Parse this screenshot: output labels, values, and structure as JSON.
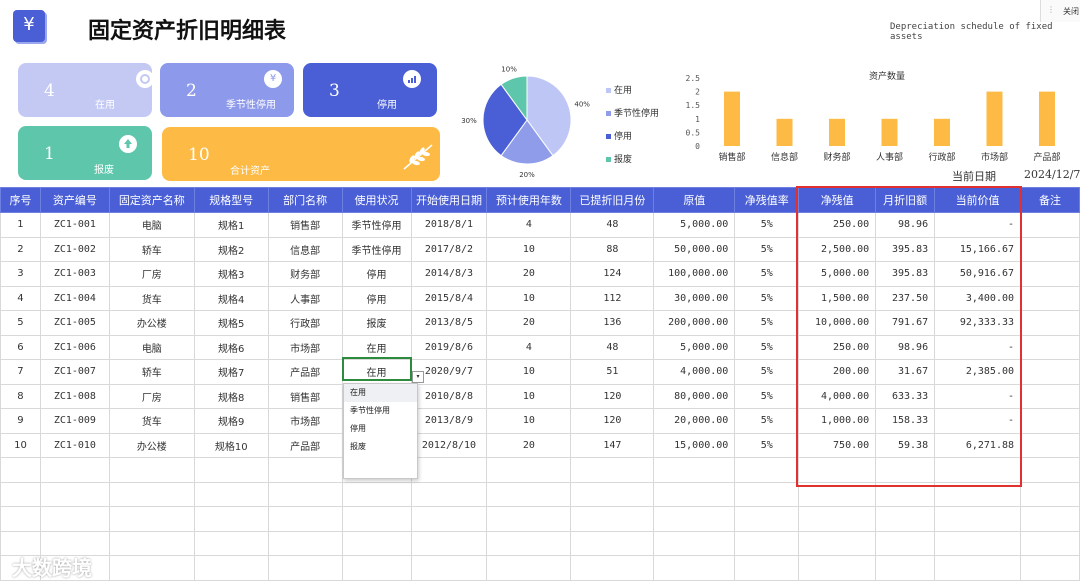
{
  "header": {
    "logo_glyph": "¥",
    "title": "固定资产折旧明细表",
    "subtitle": "Depreciation schedule of fixed assets",
    "close_label": "关闭",
    "close_sep": "⋮"
  },
  "cards": [
    {
      "num": "4",
      "label": "在用",
      "color": "#c3c9f3",
      "icon": "coin-icon"
    },
    {
      "num": "2",
      "label": "季节性停用",
      "color": "#8d99ea",
      "icon": "yen-icon"
    },
    {
      "num": "3",
      "label": "停用",
      "color": "#4a5fd6",
      "icon": "chart-icon"
    },
    {
      "num": "1",
      "label": "报废",
      "color": "#5ec7ab",
      "icon": "upload-icon"
    },
    {
      "num": "10",
      "label": "合计资产",
      "color": "#fdbb45",
      "icon": "leaf-icon"
    }
  ],
  "chart_data": [
    {
      "type": "pie",
      "categories": [
        "在用",
        "季节性停用",
        "停用",
        "报废"
      ],
      "values": [
        40,
        20,
        30,
        10
      ],
      "slice_labels": [
        "40%",
        "20%",
        "30%",
        "10%"
      ],
      "colors": [
        "#bec6f5",
        "#8f9ce9",
        "#4a5fd6",
        "#5ec7ab"
      ],
      "legend_position": "right"
    },
    {
      "type": "bar",
      "title": "资产数量",
      "categories": [
        "销售部",
        "信息部",
        "财务部",
        "人事部",
        "行政部",
        "市场部",
        "产品部"
      ],
      "values": [
        2,
        1,
        1,
        1,
        1,
        2,
        2
      ],
      "ylim": [
        0,
        2.5
      ],
      "yticks": [
        "2.5",
        "2",
        "1.5",
        "1",
        "0.5",
        "0"
      ],
      "color": "#fdbb45",
      "grid": false
    }
  ],
  "date": {
    "label": "当前日期",
    "value": "2024/12/7"
  },
  "table": {
    "headers": [
      "序号",
      "资产编号",
      "固定资产名称",
      "规格型号",
      "部门名称",
      "使用状况",
      "开始使用日期",
      "预计使用年数",
      "已提折旧月份",
      "原值",
      "净残值率",
      "净残值",
      "月折旧额",
      "当前价值",
      "备注"
    ],
    "rows": [
      [
        "1",
        "ZC1-001",
        "电脑",
        "规格1",
        "销售部",
        "季节性停用",
        "2018/8/1",
        "4",
        "48",
        "5,000.00",
        "5%",
        "250.00",
        "98.96",
        "-",
        ""
      ],
      [
        "2",
        "ZC1-002",
        "轿车",
        "规格2",
        "信息部",
        "季节性停用",
        "2017/8/2",
        "10",
        "88",
        "50,000.00",
        "5%",
        "2,500.00",
        "395.83",
        "15,166.67",
        ""
      ],
      [
        "3",
        "ZC1-003",
        "厂房",
        "规格3",
        "财务部",
        "停用",
        "2014/8/3",
        "20",
        "124",
        "100,000.00",
        "5%",
        "5,000.00",
        "395.83",
        "50,916.67",
        ""
      ],
      [
        "4",
        "ZC1-004",
        "货车",
        "规格4",
        "人事部",
        "停用",
        "2015/8/4",
        "10",
        "112",
        "30,000.00",
        "5%",
        "1,500.00",
        "237.50",
        "3,400.00",
        ""
      ],
      [
        "5",
        "ZC1-005",
        "办公楼",
        "规格5",
        "行政部",
        "报废",
        "2013/8/5",
        "20",
        "136",
        "200,000.00",
        "5%",
        "10,000.00",
        "791.67",
        "92,333.33",
        ""
      ],
      [
        "6",
        "ZC1-006",
        "电脑",
        "规格6",
        "市场部",
        "在用",
        "2019/8/6",
        "4",
        "48",
        "5,000.00",
        "5%",
        "250.00",
        "98.96",
        "-",
        ""
      ],
      [
        "7",
        "ZC1-007",
        "轿车",
        "规格7",
        "产品部",
        "在用",
        "2020/9/7",
        "10",
        "51",
        "4,000.00",
        "5%",
        "200.00",
        "31.67",
        "2,385.00",
        ""
      ],
      [
        "8",
        "ZC1-008",
        "厂房",
        "规格8",
        "销售部",
        "",
        "2010/8/8",
        "10",
        "120",
        "80,000.00",
        "5%",
        "4,000.00",
        "633.33",
        "-",
        ""
      ],
      [
        "9",
        "ZC1-009",
        "货车",
        "规格9",
        "市场部",
        "",
        "2013/8/9",
        "10",
        "120",
        "20,000.00",
        "5%",
        "1,000.00",
        "158.33",
        "-",
        ""
      ],
      [
        "10",
        "ZC1-010",
        "办公楼",
        "规格10",
        "产品部",
        "",
        "2012/8/10",
        "20",
        "147",
        "15,000.00",
        "5%",
        "750.00",
        "59.38",
        "6,271.88",
        ""
      ]
    ]
  },
  "dropdown": {
    "arrow": "▾",
    "options": [
      "在用",
      "季节性停用",
      "停用",
      "报废"
    ]
  },
  "watermark": "大数跨境"
}
